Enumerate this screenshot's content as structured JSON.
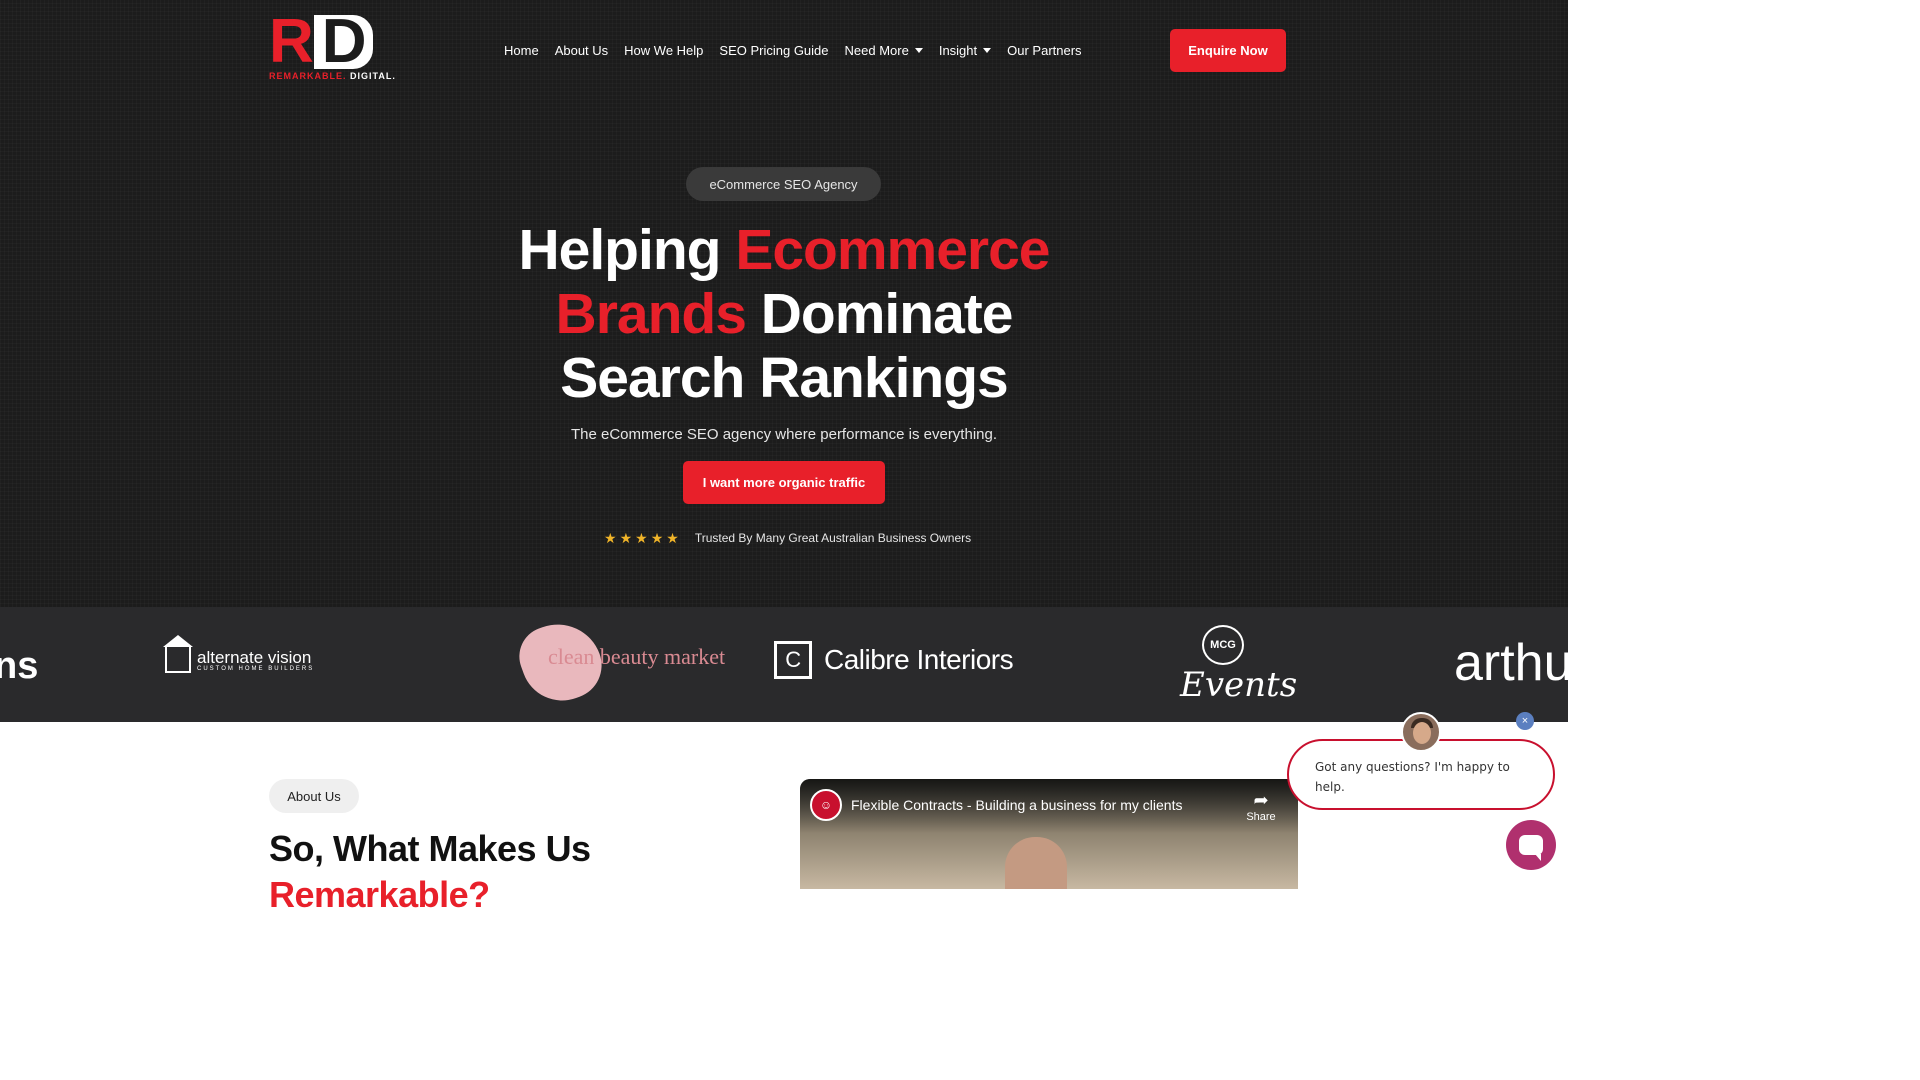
{
  "brand": {
    "logo_mark_r": "R",
    "logo_mark_d": "D",
    "logo_sub_red": "REMARKABLE.",
    "logo_sub_white": "DIGITAL.",
    "accent_color": "#e8202a"
  },
  "nav": {
    "items": [
      {
        "label": "Home",
        "has_dropdown": false
      },
      {
        "label": "About Us",
        "has_dropdown": false
      },
      {
        "label": "How We Help",
        "has_dropdown": false
      },
      {
        "label": "SEO Pricing Guide",
        "has_dropdown": false
      },
      {
        "label": "Need More",
        "has_dropdown": true
      },
      {
        "label": "Insight",
        "has_dropdown": true
      },
      {
        "label": "Our Partners",
        "has_dropdown": false
      }
    ],
    "enquire_label": "Enquire Now"
  },
  "hero": {
    "pill": "eCommerce SEO Agency",
    "headline_part1": "Helping ",
    "headline_red1": "Ecommerce",
    "headline_red2": "Brands",
    "headline_part2": " Dominate",
    "headline_part3": "Search Rankings",
    "subline": "The eCommerce SEO agency where performance is everything.",
    "cta_label": "I want more organic traffic",
    "rating_stars": 5,
    "trust_text": "Trusted By Many Great Australian Business Owners"
  },
  "client_logos": {
    "partial_left": "ns",
    "alternate_vision": "alternate vision",
    "alternate_vision_tag": "CUSTOM HOME BUILDERS",
    "clean_beauty": "clean beauty market",
    "calibre": "Calibre Interiors",
    "calibre_mark": "C",
    "mcg": "MCG",
    "mcg_events": "Events",
    "arthur_partial": "arthu"
  },
  "about": {
    "pill": "About Us",
    "heading_line1": "So, What Makes Us",
    "heading_line2": "Remarkable?"
  },
  "video": {
    "title": "Flexible Contracts - Building a business for my clients",
    "share_label": "Share"
  },
  "chat": {
    "message": "Got any questions? I'm happy to help.",
    "close_symbol": "×"
  }
}
